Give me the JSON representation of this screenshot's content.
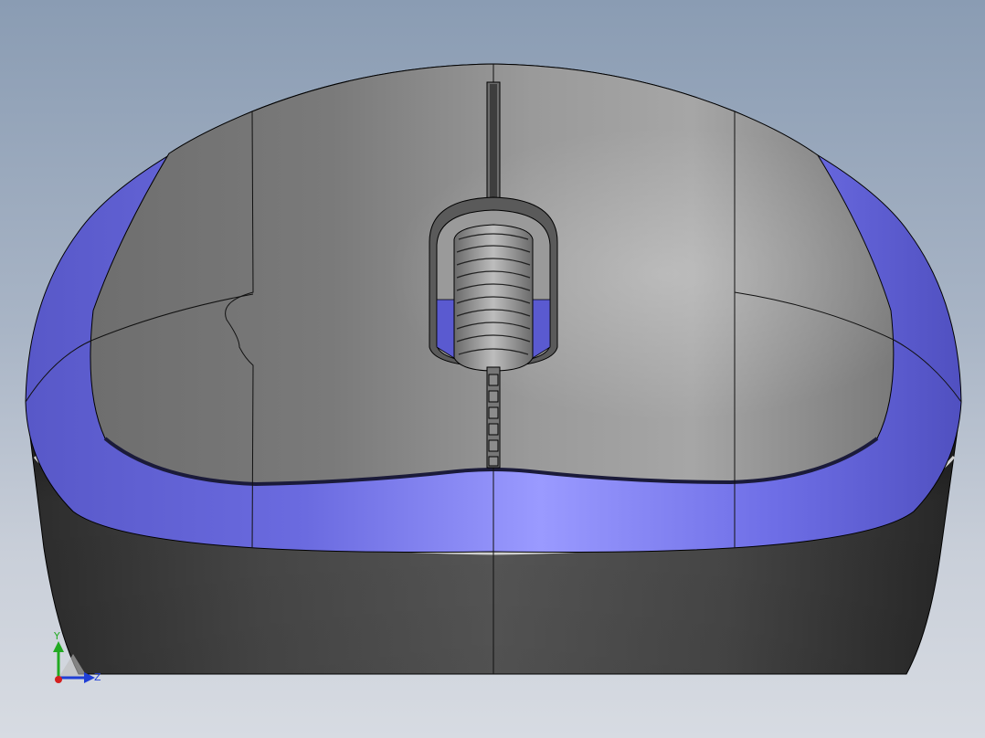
{
  "viewport": {
    "background_top": "#8a9cb3",
    "background_bottom": "#d7dbe2"
  },
  "model": {
    "icon": "computer-mouse-3d-model",
    "shell_color": "#808080",
    "base_color": "#3f3f3f",
    "accent_color": "#7272e6",
    "edge_color": "#000000"
  },
  "triad": {
    "y_label": "Y",
    "z_label": "Z",
    "y_color": "#22aa22",
    "z_color": "#1f3fd6",
    "x_color": "#d42020"
  }
}
